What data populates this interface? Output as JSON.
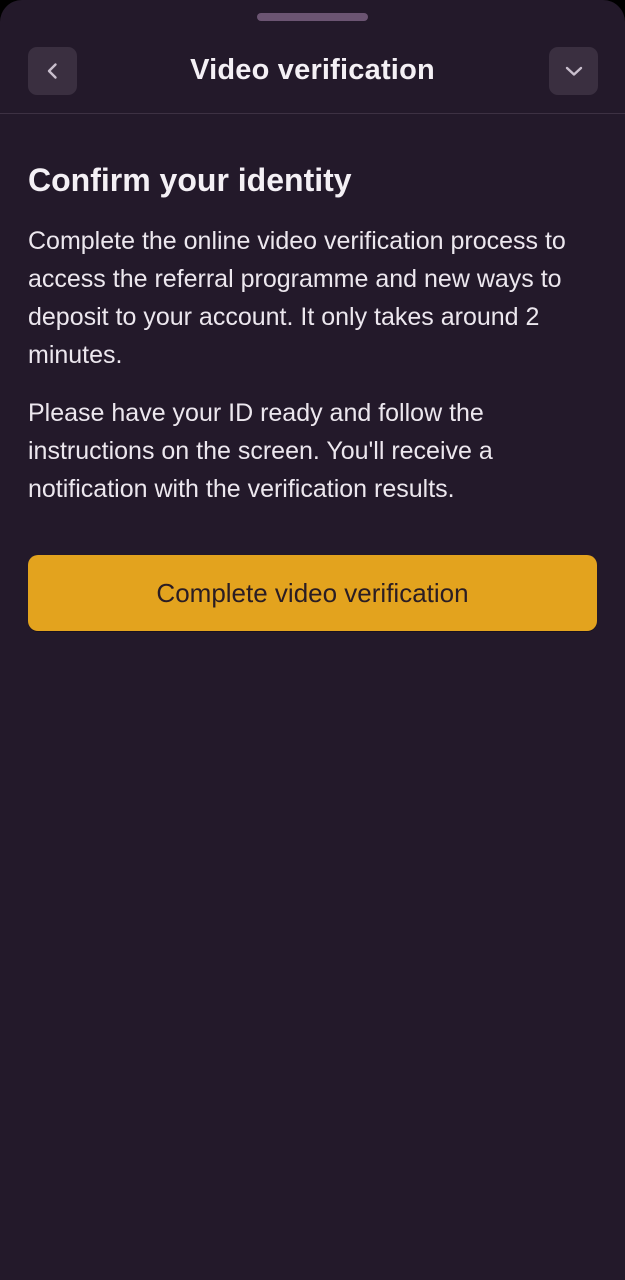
{
  "header": {
    "title": "Video verification",
    "back_icon": "chevron-left-icon",
    "collapse_icon": "chevron-down-icon"
  },
  "content": {
    "heading": "Confirm your identity",
    "paragraph1": "Complete the online video verification process to access the referral programme and new ways to deposit to your account. It only takes around 2 minutes.",
    "paragraph2": "Please have your ID ready and follow the instructions on the screen. You'll receive a notification with the verification results."
  },
  "cta": {
    "label": "Complete video verification"
  },
  "colors": {
    "background": "#23192a",
    "accent": "#e3a31e",
    "icon_button_bg": "#3a2f40",
    "grabber": "#6b5472"
  }
}
